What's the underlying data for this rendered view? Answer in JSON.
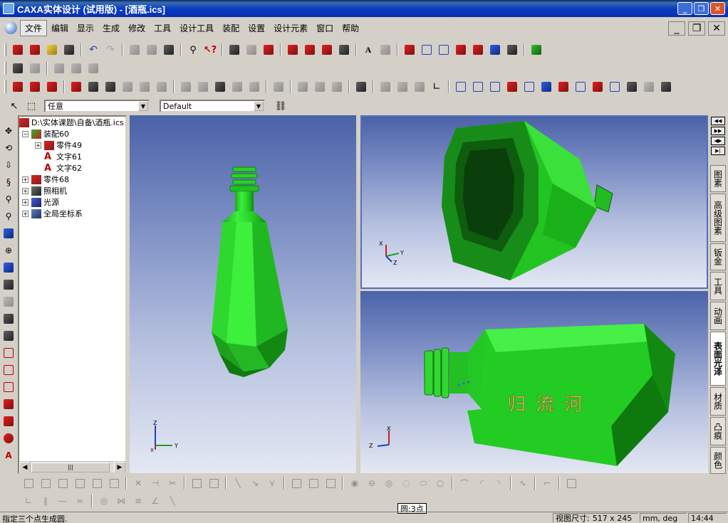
{
  "window": {
    "title": "CAXA实体设计 (试用版) - [酒瓶.ics]"
  },
  "menu": [
    "文件",
    "编辑",
    "显示",
    "生成",
    "修改",
    "工具",
    "设计工具",
    "装配",
    "设置",
    "设计元素",
    "窗口",
    "帮助"
  ],
  "selectors": {
    "filter": "任意",
    "style": "Default"
  },
  "tree": {
    "root": "D:\\实体课题\\自备\\酒瓶.ics",
    "items": [
      {
        "label": "装配60",
        "level": 1,
        "expander": "−"
      },
      {
        "label": "零件49",
        "level": 2,
        "expander": "+"
      },
      {
        "label": "文字61",
        "level": 2,
        "expander": ""
      },
      {
        "label": "文字62",
        "level": 2,
        "expander": ""
      },
      {
        "label": "零件68",
        "level": 1,
        "expander": "+"
      },
      {
        "label": "照相机",
        "level": 1,
        "expander": "+"
      },
      {
        "label": "光源",
        "level": 1,
        "expander": "+"
      },
      {
        "label": "全局坐标系",
        "level": 1,
        "expander": "+"
      }
    ]
  },
  "viewports": {
    "left_axes": {
      "z": "Z",
      "y": "Y",
      "x": "X"
    },
    "top_right_axes": {
      "x": "X",
      "y": "Y",
      "z": "Z"
    },
    "bottom_right_axes": {
      "x": "X",
      "z": "Z"
    },
    "bottle_text": "归流河"
  },
  "right_tabs": [
    "图素",
    "高级图素",
    "钣金",
    "工具",
    "动画",
    "表面光泽",
    "材质",
    "凸痕",
    "颜色"
  ],
  "right_tab_active": "表面光泽",
  "status": {
    "prompt": "指定三个点生成圆.",
    "mode": "圆:3点",
    "view_size_label": "视图尺寸:",
    "view_size": "517 x 245",
    "units": "mm, deg",
    "time": "14:44"
  },
  "colors": {
    "title_bar": "#0a3cc8",
    "bottle_green": "#22cc22",
    "viewport_top": "#4a62a8",
    "viewport_bottom": "#e4e8f4"
  }
}
